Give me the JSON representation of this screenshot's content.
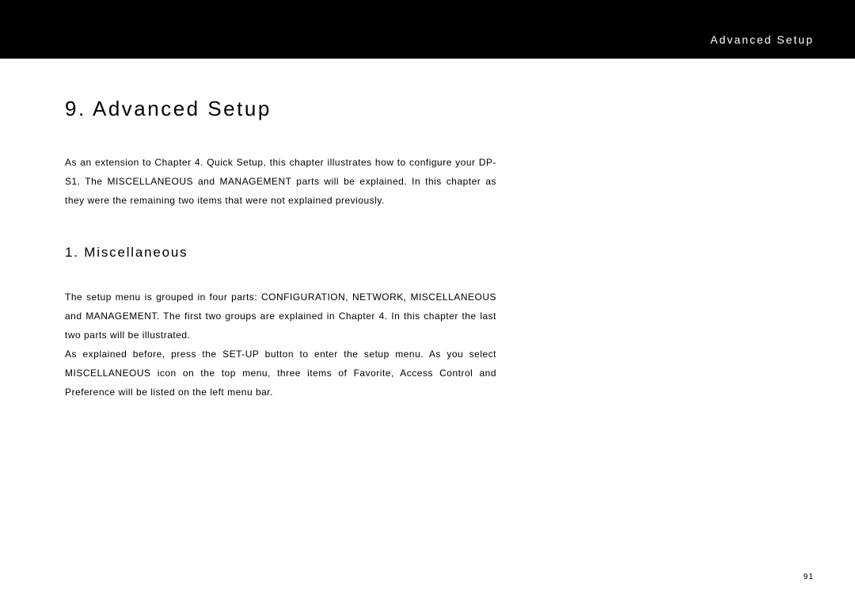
{
  "header": {
    "title": "Advanced Setup"
  },
  "chapter": {
    "title": "9.  Advanced Setup",
    "intro": "As an extension to Chapter 4. Quick Setup, this chapter illustrates how to configure your DP-S1. The MISCELLANEOUS and MANAGEMENT parts will be explained. In this chapter as they were the remaining two items that were not explained previously."
  },
  "section": {
    "title": "1. Miscellaneous",
    "body1": "The setup menu is grouped in four parts: CONFIGURATION, NETWORK, MISCELLANEOUS and MANAGEMENT. The first two groups are explained in Chapter 4. In this chapter the last two parts will be illustrated.",
    "body2": "As explained before, press the SET-UP button to enter the setup menu. As you select MISCELLANEOUS icon on the top menu, three items of Favorite, Access Control and Preference will be listed on the left menu bar."
  },
  "page_number": "91"
}
